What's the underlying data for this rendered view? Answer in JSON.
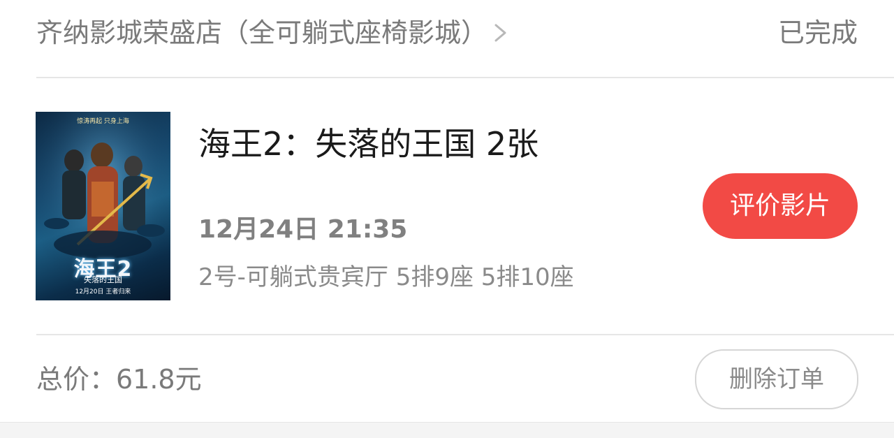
{
  "header": {
    "cinema_name": "齐纳影城荣盛店（全可躺式座椅影城）",
    "status": "已完成"
  },
  "movie": {
    "poster": {
      "tagline": "惊涛再起 只身上海",
      "logo": "海王2",
      "subtitle": "失落的王国",
      "release": "12月20日 王者归来"
    },
    "title": "海王2：失落的王国 2张",
    "showtime": "12月24日 21:35",
    "seats": "2号-可躺式贵宾厅 5排9座 5排10座",
    "review_button": "评价影片"
  },
  "footer": {
    "total": "总价：61.8元",
    "delete_button": "删除订单"
  },
  "colors": {
    "accent_red": "#f24a45",
    "text_dark": "#1a1a1a",
    "text_gray": "#7a7a7a",
    "divider": "#e6e6e6"
  }
}
